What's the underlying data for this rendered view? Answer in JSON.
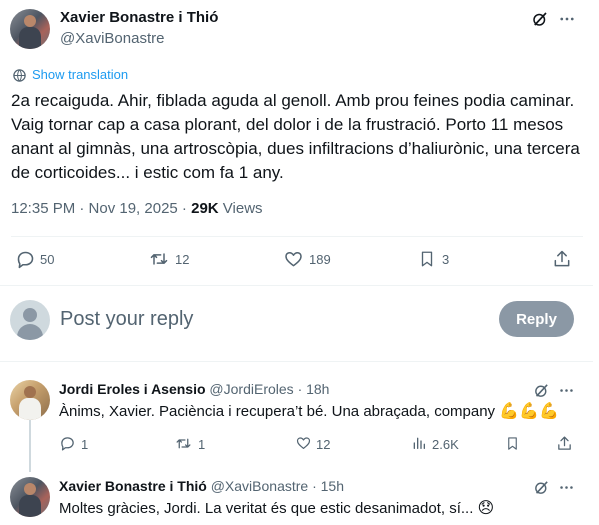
{
  "main_tweet": {
    "author_name": "Xavier Bonastre i Thió",
    "author_handle": "@XaviBonastre",
    "show_translation": "Show translation",
    "text": "2a recaiguda. Ahir, fiblada aguda al genoll. Amb prou feines podia caminar. Vaig tornar cap a casa plorant, del dolor i de la frustració. Porto 11 mesos anant al gimnàs, una artroscòpia, dues infiltracions d’haliurònic, una tercera de corticoides... i estic com fa 1 any.",
    "time": "12:35 PM · Nov 19, 2025 · ",
    "views_count": "29K",
    "views_label": " Views",
    "replies": "50",
    "reposts": "12",
    "likes": "189",
    "bookmarks": "3"
  },
  "composer": {
    "placeholder": "Post your reply",
    "button": "Reply"
  },
  "replies": [
    {
      "author_name": "Jordi Eroles i Asensio",
      "author_handle": "@JordiEroles",
      "time": "· 18h",
      "text": "Ànims, Xavier. Paciència i recupera’t bé. Una abraçada, company",
      "emoji": "💪💪💪",
      "replies": "1",
      "reposts": "1",
      "likes": "12",
      "views": "2.6K"
    },
    {
      "author_name": "Xavier Bonastre i Thió",
      "author_handle": "@XaviBonastre",
      "time": "· 15h",
      "text": "Moltes gràcies, Jordi. La veritat és que estic desanimadot, sí...",
      "emoji": "😞"
    }
  ],
  "icons": {
    "grok": "grok-icon",
    "more": "more-icon",
    "translate": "translate-icon",
    "reply": "reply-icon",
    "repost": "repost-icon",
    "like": "like-icon",
    "bookmark": "bookmark-icon",
    "share": "share-icon",
    "views": "views-icon"
  },
  "colors": {
    "link": "#1d9bf0",
    "secondary": "#536471",
    "reply_button": "#8b98a5"
  }
}
